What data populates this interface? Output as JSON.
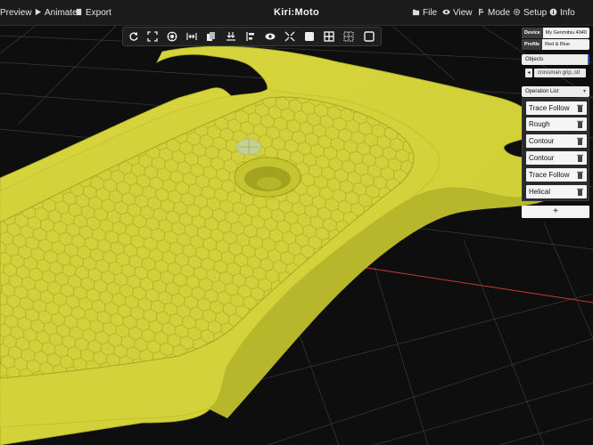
{
  "topbar": {
    "left": [
      {
        "label": "Preview",
        "icon": "preview-icon"
      },
      {
        "label": "Animate",
        "icon": "play-icon"
      },
      {
        "label": "Export",
        "icon": "file-export-icon"
      }
    ],
    "brand": "Kiri:Moto",
    "right": [
      {
        "label": "File",
        "icon": "folder-icon"
      },
      {
        "label": "View",
        "icon": "eye-icon"
      },
      {
        "label": "Mode",
        "icon": "mode-icon"
      },
      {
        "label": "Setup",
        "icon": "gear-icon"
      },
      {
        "label": "Info",
        "icon": "info-icon"
      }
    ]
  },
  "toolbar": {
    "buttons": [
      "reset-view-icon",
      "fit-view-icon",
      "select-all-icon",
      "space-out-icon",
      "duplicate-icon",
      "lay-flat-icon",
      "align-icon",
      "visibility-icon",
      "mirror-icon",
      "solid-view-icon",
      "grid-view-icon",
      "wire-view-icon",
      "wireframe-icon"
    ]
  },
  "panel": {
    "device_tag": "Device",
    "device_value": "My Genmitsu 4040",
    "profile_tag": "Profile",
    "profile_value": "Red & Blue",
    "objects_header": "Objects",
    "object_name": "crossman grip..stl",
    "oplist_header": "Operation List",
    "operations": [
      "Trace Follow",
      "Rough",
      "Contour",
      "Contour",
      "Trace Follow",
      "Helical"
    ],
    "add_label": "+"
  },
  "colors": {
    "part": "#d6d43a",
    "part_shade": "#c2c12c",
    "background": "#0e0e0e",
    "grid": "#3a3a3a",
    "axis_red": "#c43a3a"
  }
}
